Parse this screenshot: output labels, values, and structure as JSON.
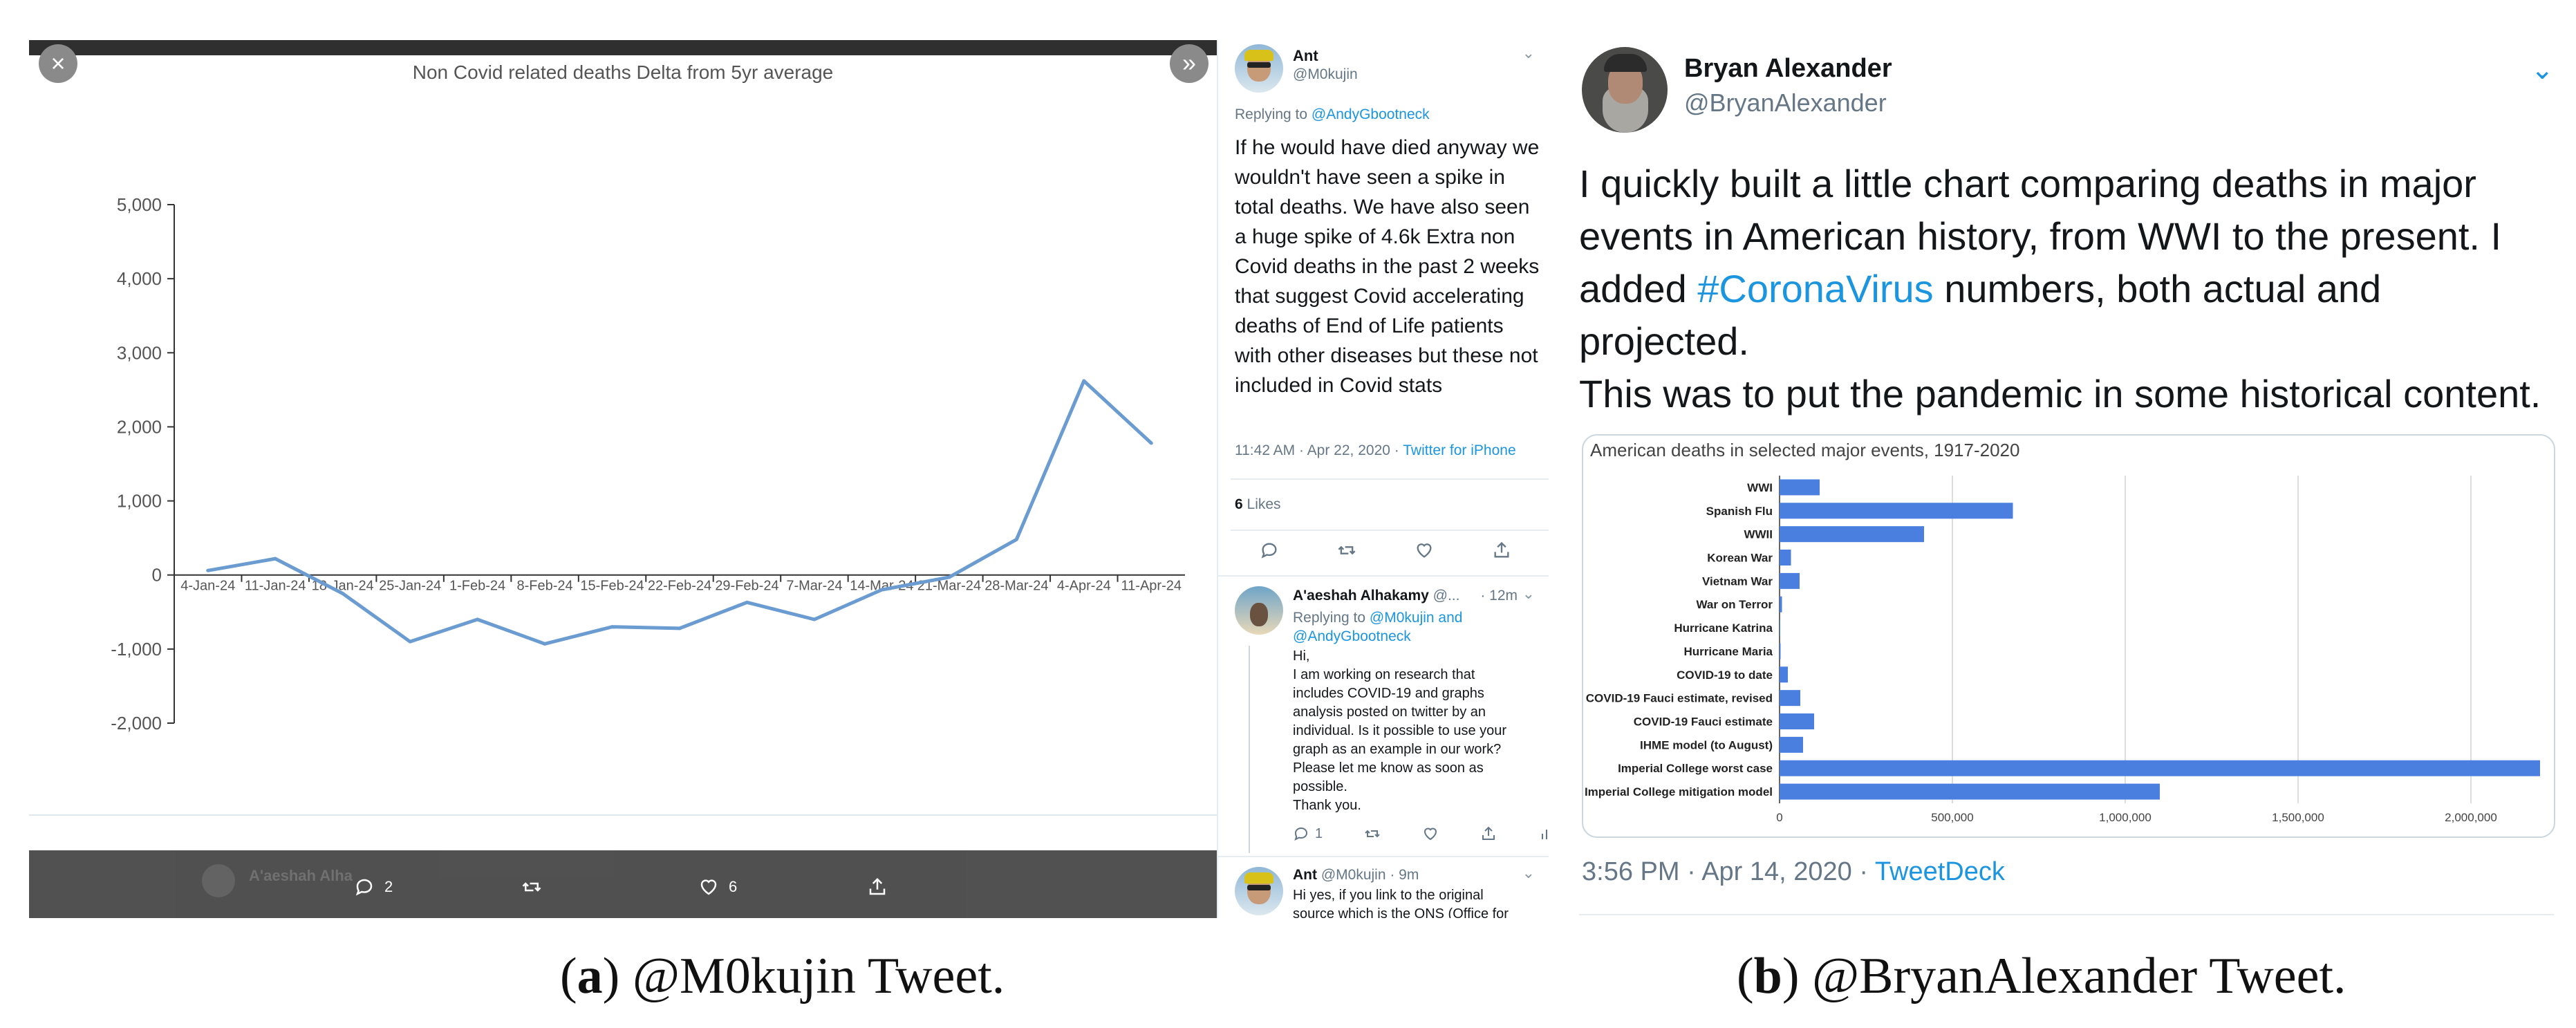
{
  "panel_a": {
    "close_icon": "close-icon",
    "next_icon": "double-chevron-right-icon",
    "ghost_name": "A'aeshah Alha",
    "actions": {
      "reply_count": "2",
      "like_count": "6"
    },
    "chart_data": {
      "type": "line",
      "title": "Non Covid related deaths Delta from 5yr average",
      "categories": [
        "4-Jan-24",
        "11-Jan-24",
        "18-Jan-24",
        "25-Jan-24",
        "1-Feb-24",
        "8-Feb-24",
        "15-Feb-24",
        "22-Feb-24",
        "29-Feb-24",
        "7-Mar-24",
        "14-Mar-24",
        "21-Mar-24",
        "28-Mar-24",
        "4-Apr-24",
        "11-Apr-24"
      ],
      "values": [
        60,
        220,
        -250,
        -900,
        -600,
        -930,
        -700,
        -720,
        -370,
        -600,
        -200,
        -30,
        480,
        2620,
        1780
      ],
      "yticks": [
        "5,000",
        "4,000",
        "3,000",
        "2,000",
        "1,000",
        "0",
        "-1,000",
        "-2,000"
      ],
      "ylim": [
        -2000,
        5000
      ],
      "color": "#6a9bd1"
    }
  },
  "thread": {
    "tweet1": {
      "name": "Ant",
      "handle": "@M0kujin",
      "replying_prefix": "Replying to",
      "replying_to": "@AndyGbootneck",
      "text": "If he would have died anyway we wouldn't have seen a spike in total deaths.  We have also seen a huge spike of 4.6k Extra non Covid deaths in the past 2 weeks that suggest Covid accelerating deaths of End of Life patients with other diseases but these not included in Covid stats",
      "time": "11:42 AM · Apr 22, 2020 ·",
      "source": "Twitter for iPhone",
      "likes_count": "6",
      "likes_label": "Likes"
    },
    "tweet2": {
      "name": "A'aeshah Alhakamy",
      "handle": "@...",
      "time": "· 12m",
      "replying_prefix": "Replying to",
      "replying_to": "@M0kujin and @AndyGbootneck",
      "text_lines": [
        "Hi,",
        "I am working on research that",
        "includes COVID-19 and graphs",
        "analysis posted on twitter by an",
        "individual. Is it possible to use your",
        "graph as an example in our work?",
        "Please let me know as soon as",
        "possible.",
        "Thank you."
      ],
      "reply_count": "1"
    },
    "tweet3": {
      "name": "Ant",
      "handle": "@M0kujin · 9m",
      "text_lines": [
        "Hi yes, if you link to the original",
        "source which is the ONS (Office for"
      ]
    }
  },
  "panel_b": {
    "name": "Bryan Alexander",
    "handle": "@BryanAlexander",
    "text_before": "I quickly built a little chart comparing deaths in major events in American history, from WWI to the present. I added ",
    "hashtag": "#CoronaVirus",
    "text_after": " numbers, both actual and projected.",
    "text_line2": "This was to put the pandemic in some historical content.",
    "time": "3:56 PM · Apr 14, 2020 ·",
    "source": "TweetDeck",
    "chart_data": {
      "type": "bar",
      "orientation": "horizontal",
      "title": "American deaths in selected major events, 1917-2020",
      "categories": [
        "WWI",
        "Spanish Flu",
        "WWII",
        "Korean War",
        "Vietnam War",
        "War on Terror",
        "Hurricane Katrina",
        "Hurricane Maria",
        "COVID-19 to date",
        "COVID-19 Fauci estimate, revised",
        "COVID-19 Fauci estimate",
        "IHME model (to August)",
        "Imperial College worst case",
        "Imperial College mitigation model"
      ],
      "values": [
        116000,
        675000,
        418000,
        33000,
        58000,
        7000,
        1800,
        3000,
        24000,
        60000,
        100000,
        68000,
        2200000,
        1100000
      ],
      "xticks": [
        "0",
        "500,000",
        "1,000,000",
        "1,500,000",
        "2,000,000"
      ],
      "xlim": [
        0,
        2200000
      ],
      "grid": true,
      "color": "#4a7fe0"
    }
  },
  "captions": {
    "a_label": "a",
    "a_text": "@M0kujin Tweet.",
    "b_label": "b",
    "b_text": "@BryanAlexander Tweet."
  }
}
